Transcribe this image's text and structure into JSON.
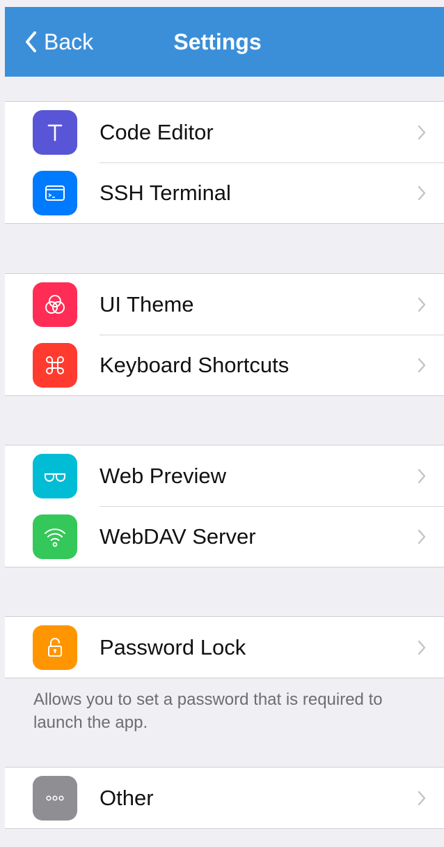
{
  "nav": {
    "back_label": "Back",
    "title": "Settings"
  },
  "groups": [
    {
      "items": [
        {
          "label": "Code Editor",
          "icon": "text-t-icon",
          "color": "#5856d6"
        },
        {
          "label": "SSH Terminal",
          "icon": "terminal-icon",
          "color": "#007aff"
        }
      ]
    },
    {
      "items": [
        {
          "label": "UI Theme",
          "icon": "circles-icon",
          "color": "#ff2d55"
        },
        {
          "label": "Keyboard Shortcuts",
          "icon": "command-icon",
          "color": "#ff3b30"
        }
      ]
    },
    {
      "items": [
        {
          "label": "Web Preview",
          "icon": "glasses-icon",
          "color": "#00bcd4"
        },
        {
          "label": "WebDAV Server",
          "icon": "wifi-icon",
          "color": "#34c759"
        }
      ]
    },
    {
      "items": [
        {
          "label": "Password Lock",
          "icon": "lock-icon",
          "color": "#ff9500"
        }
      ],
      "footer": "Allows you to set a password that is required to launch the app."
    },
    {
      "items": [
        {
          "label": "Other",
          "icon": "more-dots-icon",
          "color": "#8e8e93"
        }
      ]
    }
  ]
}
